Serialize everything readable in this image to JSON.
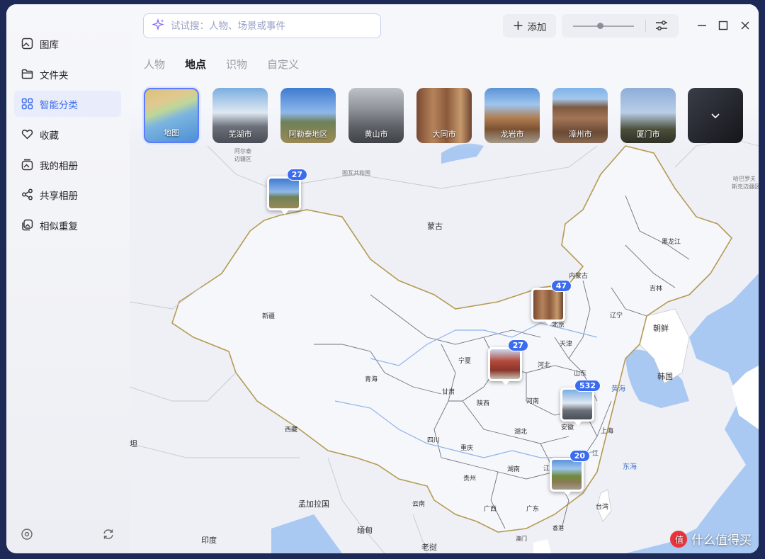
{
  "sidebar": {
    "items": [
      {
        "label": "图库",
        "icon": "gallery-icon"
      },
      {
        "label": "文件夹",
        "icon": "folder-icon"
      },
      {
        "label": "智能分类",
        "icon": "grid-icon",
        "active": true
      },
      {
        "label": "收藏",
        "icon": "heart-icon"
      },
      {
        "label": "我的相册",
        "icon": "album-icon"
      },
      {
        "label": "共享相册",
        "icon": "share-icon"
      },
      {
        "label": "相似重复",
        "icon": "duplicate-icon"
      }
    ],
    "bottom_icons": [
      "settings-icon",
      "sync-icon"
    ]
  },
  "search": {
    "placeholder": "试试搜：人物、场景或事件",
    "value": ""
  },
  "toolbar": {
    "add_label": "添加",
    "zoom_level": 0.45
  },
  "tabs": [
    {
      "label": "人物"
    },
    {
      "label": "地点",
      "active": true
    },
    {
      "label": "识物"
    },
    {
      "label": "自定义"
    }
  ],
  "places": [
    {
      "label": "地图",
      "selected": true
    },
    {
      "label": "芜湖市"
    },
    {
      "label": "阿勒泰地区"
    },
    {
      "label": "黄山市"
    },
    {
      "label": "大同市"
    },
    {
      "label": "龙岩市"
    },
    {
      "label": "漳州市"
    },
    {
      "label": "厦门市"
    }
  ],
  "map": {
    "pins": [
      {
        "count": "27"
      },
      {
        "count": "47"
      },
      {
        "count": "27"
      },
      {
        "count": "532"
      },
      {
        "count": "20"
      }
    ],
    "labels": {
      "mongolia": "蒙古",
      "xinjiang": "新疆",
      "qinghai": "青海",
      "xizang": "西藏",
      "sichuan": "四川",
      "gansu": "甘肃",
      "ningxia": "宁夏",
      "shaanxi": "陕西",
      "henan": "河南",
      "hebei": "河北",
      "shandong": "山东",
      "beijing": "北京",
      "tianjin": "天津",
      "inner_mongolia": "内蒙古",
      "heilongjiang": "黑龙江",
      "jilin": "吉林",
      "liaoning": "辽宁",
      "anhui": "安徽",
      "hubei": "湖北",
      "hunan": "湖南",
      "chongqing": "重庆",
      "guizhou": "贵州",
      "yunnan": "云南",
      "guangxi": "广西",
      "guangdong": "广东",
      "hongkong": "香港",
      "macau": "澳门",
      "taiwan": "台湾",
      "shanghai": "上海",
      "jiangxi": "江",
      "zhejiang": "江",
      "north_korea": "朝鲜",
      "south_korea": "韩国",
      "yellow_sea": "黄海",
      "east_sea": "东海",
      "bangladesh": "孟加拉国",
      "india": "印度",
      "myanmar": "缅甸",
      "laos": "老挝",
      "left_edge": "坦",
      "aer_tai": "阿尔泰",
      "bianjiang": "边疆区",
      "republic": "图瓦共和国",
      "khabarovsk": "哈巴罗夫",
      "khabarovsk2": "斯克边疆区"
    }
  },
  "watermark": "什么值得买"
}
